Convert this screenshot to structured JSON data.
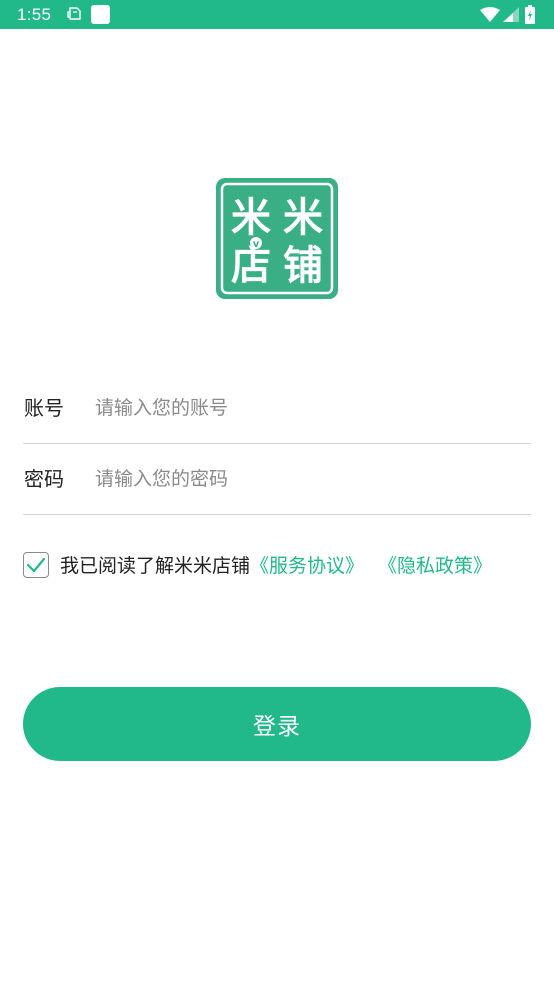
{
  "status_bar": {
    "time": "1:55",
    "background_color": "#21b88a",
    "icons": [
      "notification-icon",
      "app-square-icon",
      "wifi-icon",
      "cellular-signal-icon",
      "battery-icon"
    ]
  },
  "logo": {
    "chars": [
      "米",
      "米",
      "店",
      "铺"
    ],
    "badge": "v",
    "color": "#3aaf86"
  },
  "form": {
    "account": {
      "label": "账号",
      "placeholder": "请输入您的账号",
      "value": ""
    },
    "password": {
      "label": "密码",
      "placeholder": "请输入您的密码",
      "value": ""
    }
  },
  "agreement": {
    "checked": true,
    "text": "我已阅读了解米米店铺",
    "service_link": "《服务协议》",
    "privacy_link": "《隐私政策》",
    "link_color": "#21b88a"
  },
  "login_button": {
    "label": "登录",
    "color": "#21b88a"
  }
}
